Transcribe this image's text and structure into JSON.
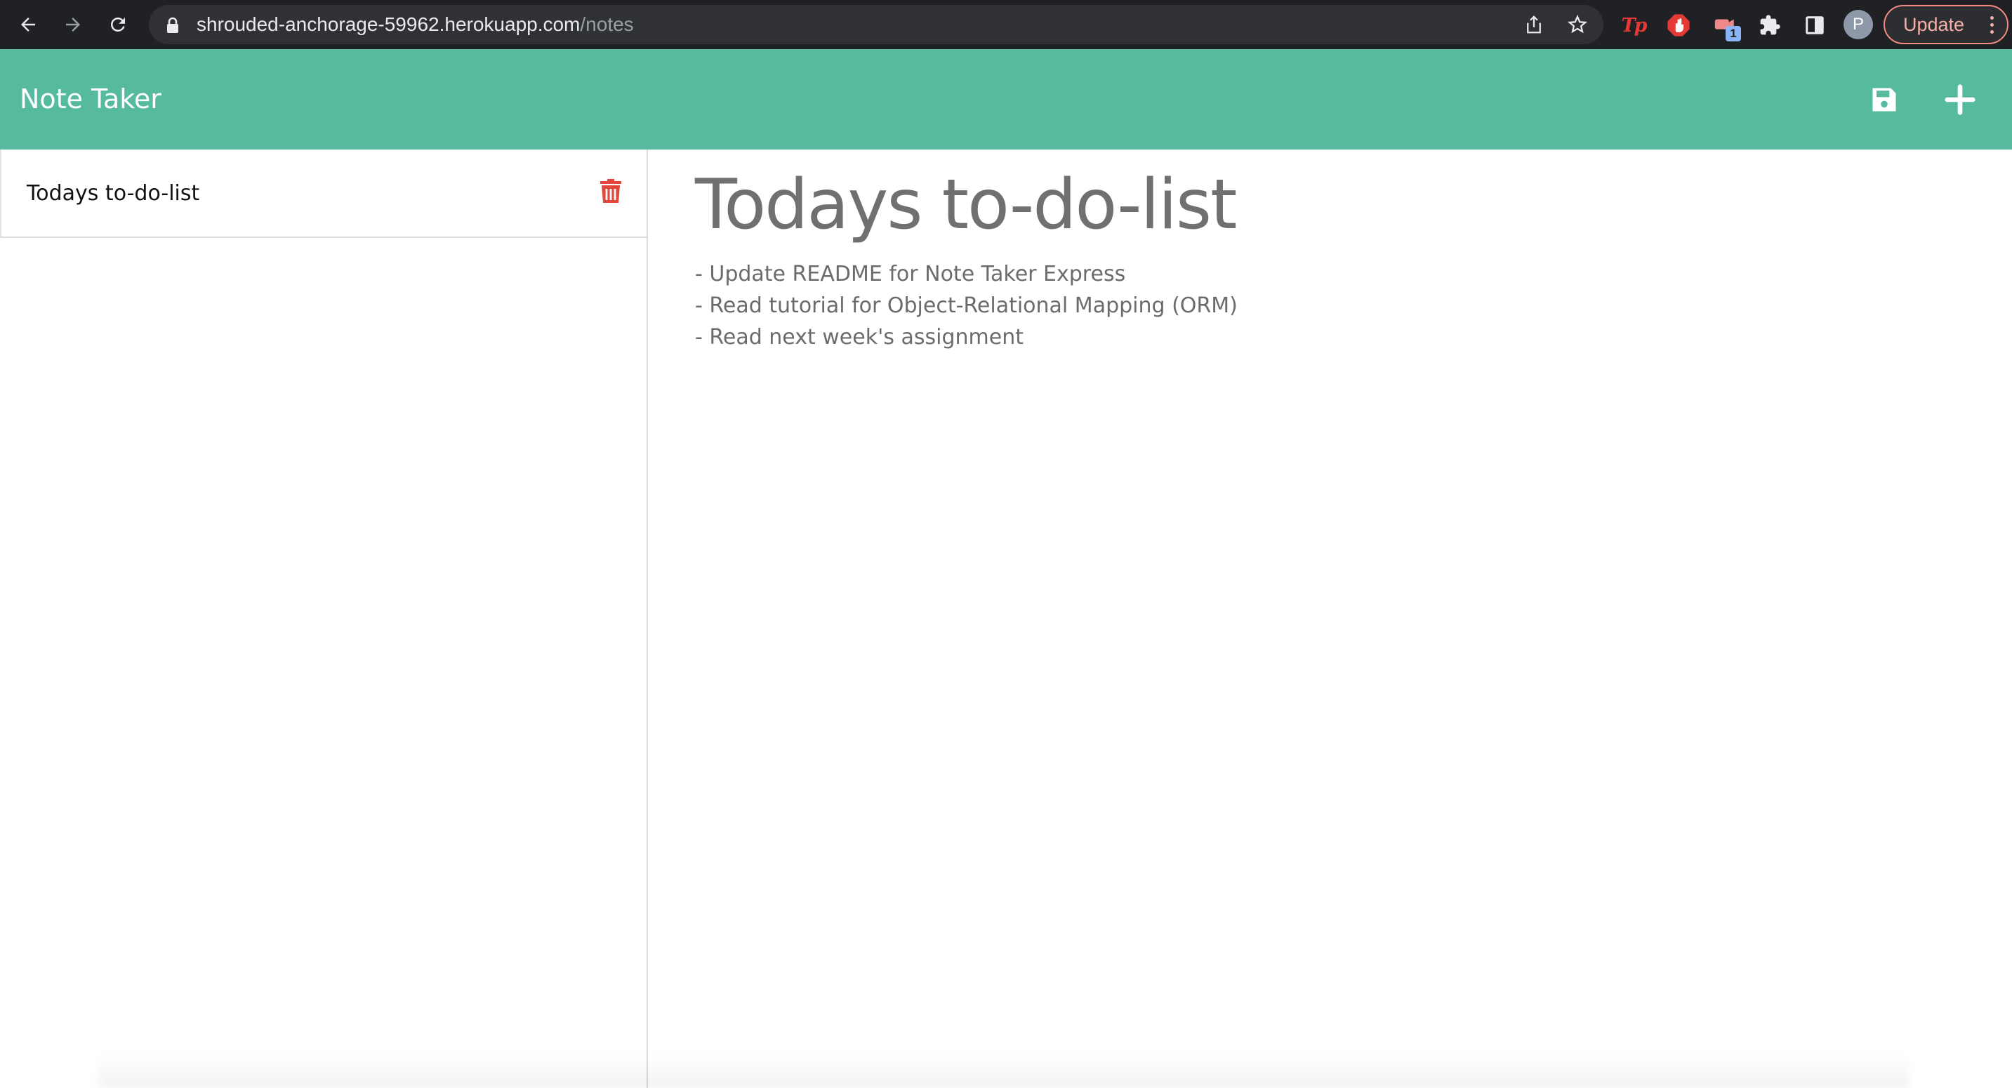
{
  "browser": {
    "url_host": "shrouded-anchorage-59962.herokuapp.com",
    "url_path": "/notes",
    "extensions": [
      {
        "name": "tp-extension-icon",
        "label": "Tp"
      },
      {
        "name": "adblock-icon"
      },
      {
        "name": "screencast-extension-icon",
        "badge": "1"
      },
      {
        "name": "puzzle-icon"
      }
    ],
    "profile_initial": "P",
    "update_label": "Update"
  },
  "app": {
    "title": "Note Taker",
    "header_color": "#56bb9e"
  },
  "sidebar": {
    "notes": [
      {
        "title": "Todays to-do-list"
      }
    ]
  },
  "note": {
    "title": "Todays to-do-list",
    "body_lines": [
      "- Update README for Note Taker Express",
      "- Read tutorial for Object-Relational Mapping (ORM)",
      "- Read next week's assignment"
    ]
  },
  "colors": {
    "delete_icon": "#e2473b"
  }
}
